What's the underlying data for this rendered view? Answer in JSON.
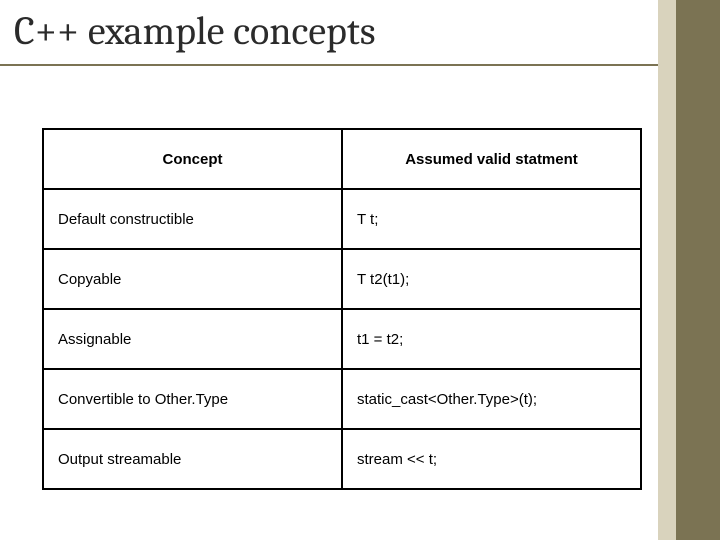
{
  "title": "C++ example concepts",
  "table": {
    "headers": {
      "concept": "Concept",
      "statement": "Assumed valid statment"
    },
    "rows": [
      {
        "concept": "Default constructible",
        "statement": "T t;"
      },
      {
        "concept": "Copyable",
        "statement": "T t2(t1);"
      },
      {
        "concept": "Assignable",
        "statement": "t1 = t2;"
      },
      {
        "concept": "Convertible to Other.Type",
        "statement": "static_cast<Other.Type>(t);"
      },
      {
        "concept": "Output streamable",
        "statement": "stream << t;"
      }
    ]
  }
}
